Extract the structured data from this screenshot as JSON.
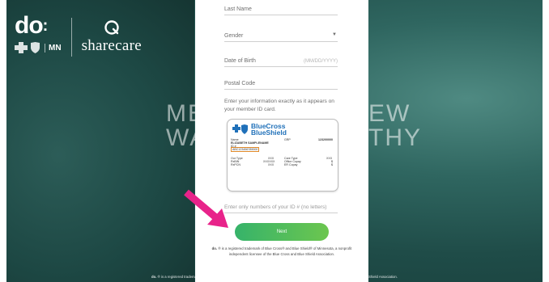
{
  "brand": {
    "do_mark": "do",
    "state": "MN",
    "partner": "sharecare"
  },
  "hero": {
    "left_line1": "ME",
    "left_line2": "WA",
    "right_line1": "EW",
    "right_line2": "THY"
  },
  "form": {
    "last_name_label": "Last Name",
    "gender_label": "Gender",
    "dob_label": "Date of Birth",
    "dob_placeholder": "(MM/DD/YYYY)",
    "postal_label": "Postal Code",
    "help_text": "Enter your information exactly as it appears on your member ID card.",
    "id_field_label": "Enter only numbers of your ID # (no letters)",
    "next_label": "Next",
    "legal_text_1": "® is a registered trademark of Blue Cross® and Blue Shield® of Minnesota, a nonprofit independent licensee of the Blue Cross and Blue Shield Association.",
    "legal_mark": "do."
  },
  "id_card": {
    "brand_line1": "BlueCross",
    "brand_line2": "BlueShield",
    "name_label": "Name",
    "name_value": "ELIZABETH SAMPLENAME",
    "id_label": "ID #",
    "id_value": "ABC123456789000",
    "grp_label": "GRP",
    "grp_value": "123200000",
    "rx_rows": [
      [
        "Our Type",
        "XXX",
        "Care Type",
        "XXX"
      ],
      [
        "RxBIN",
        "XXXXXX",
        "Office Copay",
        "$"
      ],
      [
        "RxPCN",
        "XXX",
        "ER Copay",
        "$"
      ]
    ]
  },
  "footer": {
    "text": "® is a registered trademark of Blue Cross® and Blue Shield® of Minnesota, a nonprofit independent licensee of the Blue Cross and Blue Shield Association.",
    "mark": "do."
  },
  "colors": {
    "accent_green": "#36b36a",
    "arrow_pink": "#e8238a",
    "bcbs_blue": "#1f70b9"
  }
}
